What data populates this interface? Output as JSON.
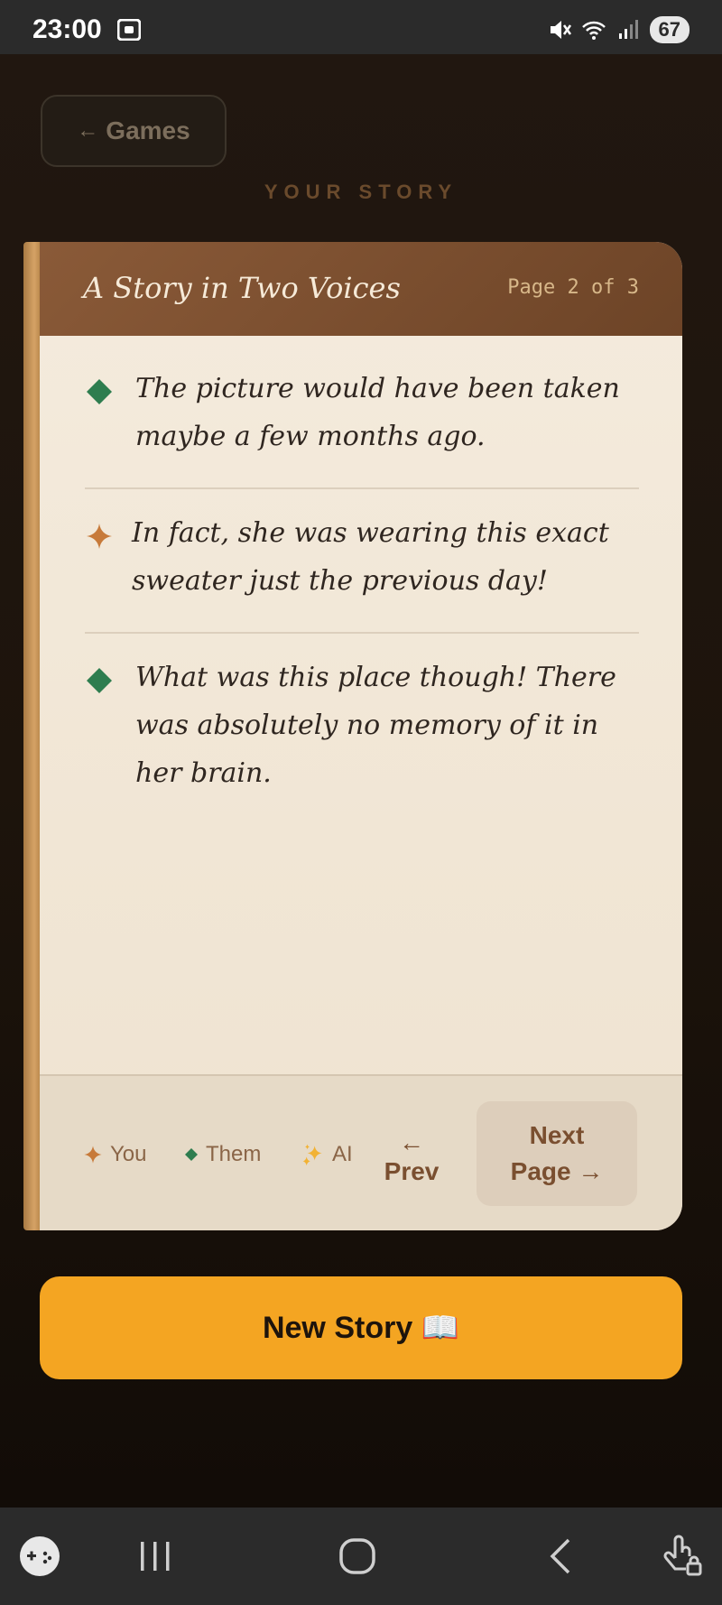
{
  "status_bar": {
    "time": "23:00",
    "battery": "67",
    "icons": [
      "screenshot-icon",
      "mute-icon",
      "wifi-icon",
      "signal-icon"
    ]
  },
  "header": {
    "back_label": "Games",
    "section_label": "YOUR STORY"
  },
  "story": {
    "title": "A Story in Two Voices",
    "page_indicator": "Page 2 of 3",
    "entries": [
      {
        "author": "them",
        "marker": "diamond-icon",
        "color": "#2e7d4f",
        "text": "The picture would have been taken maybe a few months ago."
      },
      {
        "author": "you",
        "marker": "sparkle-icon",
        "color": "#c77a3a",
        "text": "In fact, she was wearing this exact sweater just the previous day!"
      },
      {
        "author": "them",
        "marker": "diamond-icon",
        "color": "#2e7d4f",
        "text": "What was this place though! There was absolutely no memory of it in her brain."
      }
    ]
  },
  "legend": {
    "you": "You",
    "them": "Them",
    "ai": "AI"
  },
  "pager": {
    "prev_arrow": "←",
    "prev_label": "Prev",
    "next_line1": "Next",
    "next_line2": "Page →"
  },
  "actions": {
    "new_story": "New Story 📖"
  },
  "colors": {
    "accent": "#f4a522",
    "header_brown": "#7a4c2e",
    "them_green": "#2e7d4f",
    "you_orange": "#c77a3a"
  }
}
